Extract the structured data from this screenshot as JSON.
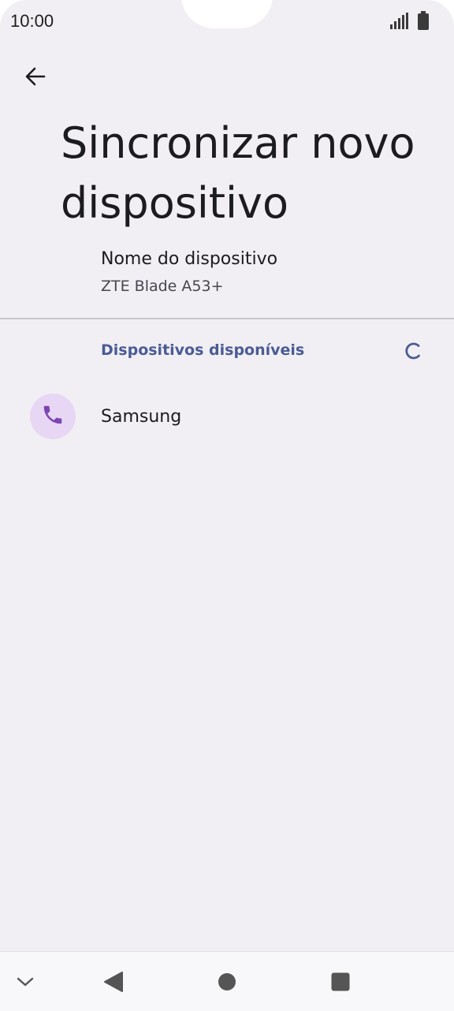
{
  "status_bar": {
    "time": "10:00",
    "icons": [
      "signal-icon",
      "battery-icon"
    ]
  },
  "header": {
    "back_icon": "arrow-back-icon",
    "title": "Sincronizar novo dispositivo"
  },
  "device_name": {
    "title": "Nome do dispositivo",
    "value": "ZTE Blade A53+"
  },
  "available_devices": {
    "header": "Dispositivos disponíveis",
    "loading_icon": "spinner-icon",
    "items": [
      {
        "label": "Samsung",
        "icon": "phone-icon"
      }
    ]
  },
  "nav_bar": {
    "icons": [
      "chevron-down-icon",
      "back-triangle-icon",
      "home-circle-icon",
      "recents-square-icon"
    ]
  },
  "colors": {
    "background": "#f1eff3",
    "accent": "#4a5b95",
    "avatar_bg": "#e8d6f5",
    "avatar_icon": "#7b46b0"
  }
}
